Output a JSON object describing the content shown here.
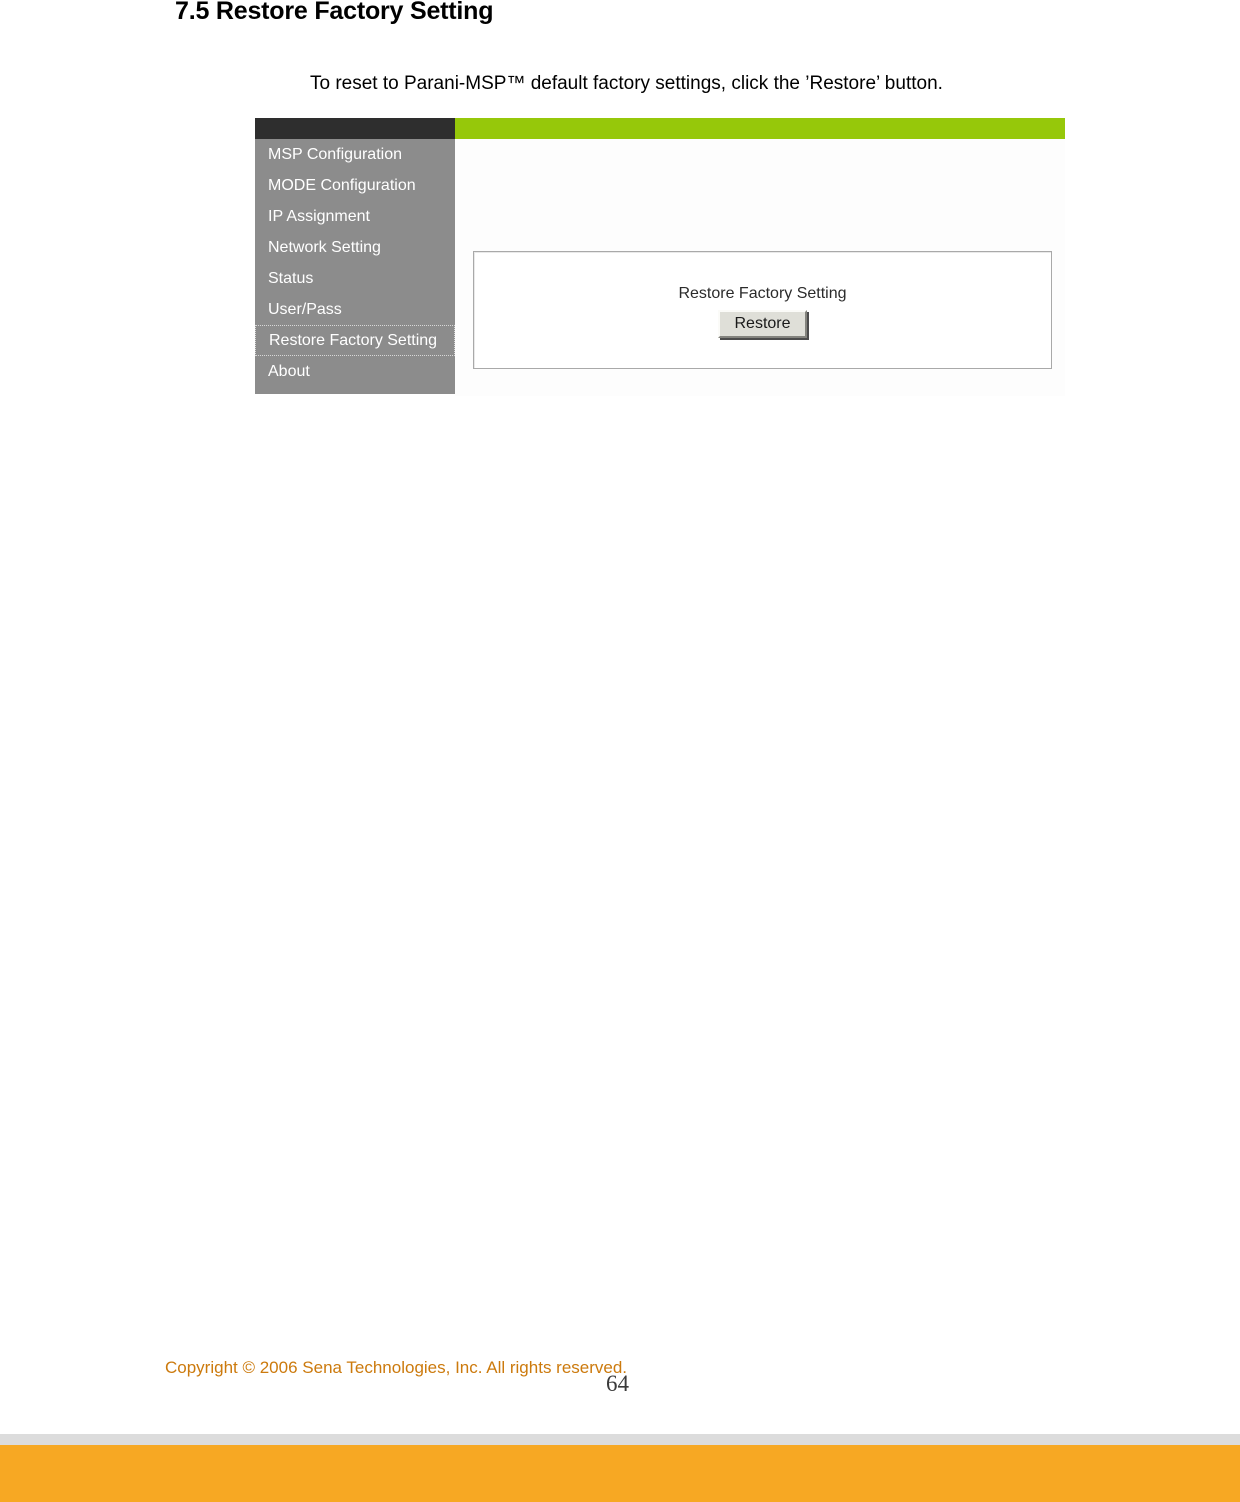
{
  "document": {
    "heading": "7.5 Restore Factory Setting",
    "intro_text": "To reset to Parani-MSP™ default factory settings, click the ’Restore’ button.",
    "page_number": "64",
    "copyright": "Copyright © 2006 Sena Technologies, Inc. All rights reserved."
  },
  "webui": {
    "topbar": {
      "dark_color": "#2e2e2e",
      "green_color": "#96c80a"
    },
    "sidebar": {
      "background_color": "#8c8c8c",
      "items": [
        {
          "label": "MSP Configuration",
          "focused": false
        },
        {
          "label": "MODE Configuration",
          "focused": false
        },
        {
          "label": "IP Assignment",
          "focused": false
        },
        {
          "label": "Network Setting",
          "focused": false
        },
        {
          "label": "Status",
          "focused": false
        },
        {
          "label": "User/Pass",
          "focused": false
        },
        {
          "label": "Restore Factory Setting",
          "focused": true
        },
        {
          "label": "About",
          "focused": false
        }
      ]
    },
    "panel": {
      "title": "Restore Factory Setting",
      "button_label": "Restore"
    }
  },
  "colors": {
    "accent_green": "#96c80a",
    "footer_orange": "#f7a823",
    "footer_gray": "#dcdcdc",
    "copyright_orange": "#cc7a0d"
  }
}
